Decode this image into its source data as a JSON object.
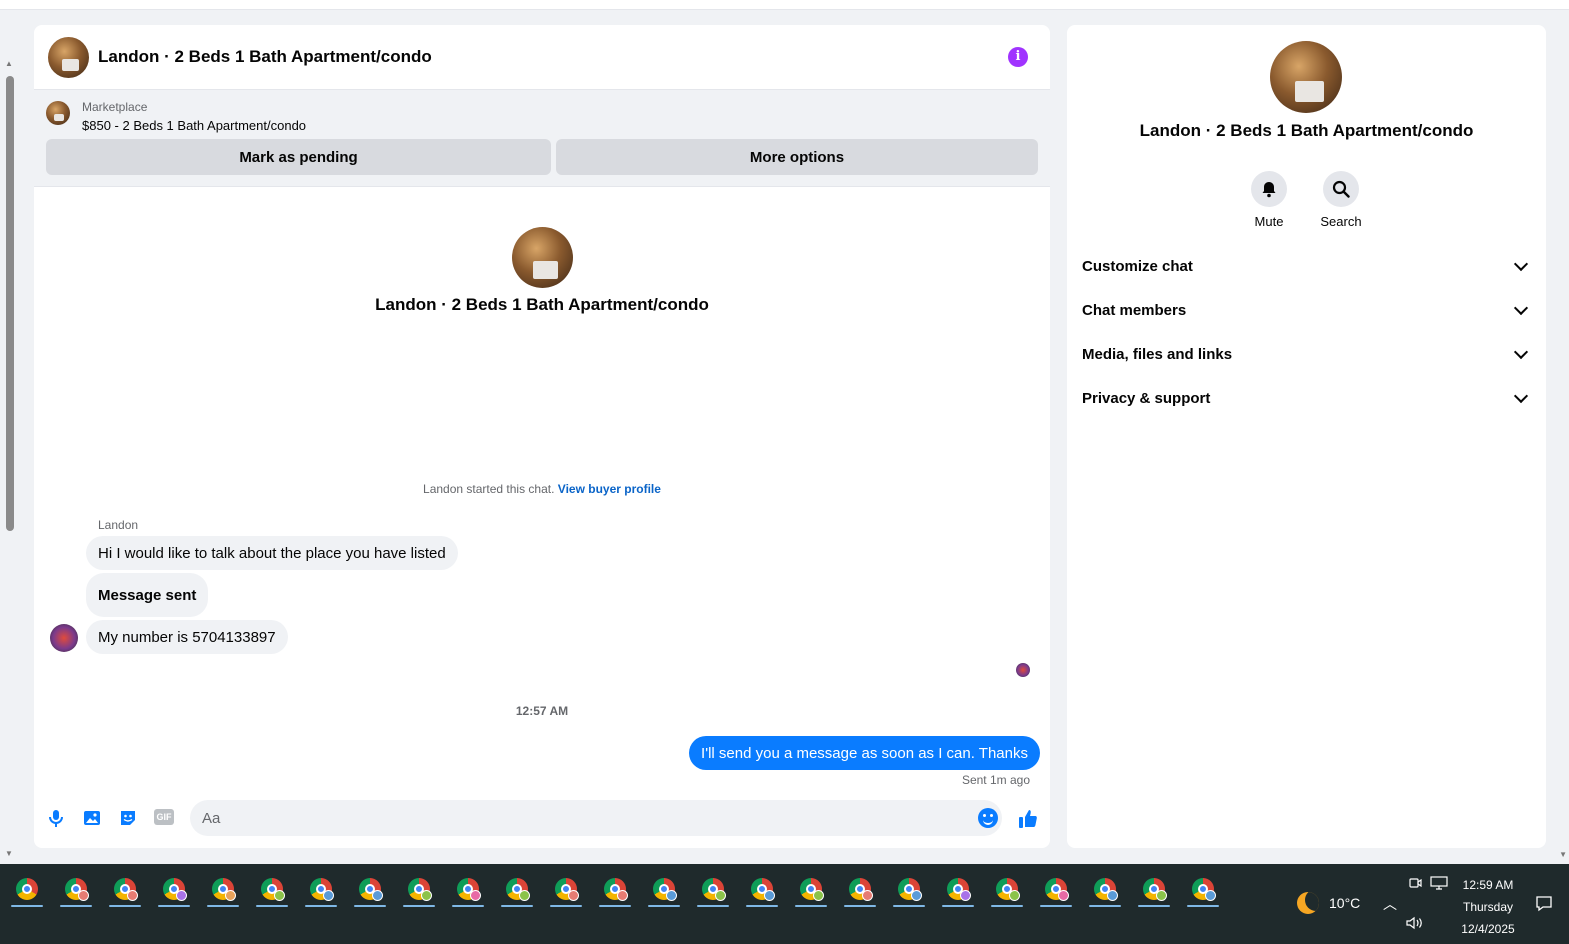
{
  "chat": {
    "title": "Landon · 2 Beds 1 Bath Apartment/condo",
    "marketplace": {
      "label": "Marketplace",
      "listing": "$850 - 2 Beds 1 Bath Apartment/condo",
      "pending_button": "Mark as pending",
      "more_button": "More options"
    },
    "intro_name": "Landon · 2 Beds 1 Bath Apartment/condo",
    "started_text": "Landon started this chat.",
    "buyer_profile_link": "View buyer profile",
    "sender_name": "Landon",
    "messages": [
      "Hi I would like to talk about the place you have listed",
      "Message sent",
      "My number is 5704133897"
    ],
    "timestamp": "12:57 AM",
    "outgoing": "I'll send you a message as soon as I can. Thanks",
    "sent_status": "Sent 1m ago",
    "composer": {
      "placeholder": "Aa",
      "gif_label": "GIF"
    }
  },
  "sidebar": {
    "name": "Landon · 2 Beds 1 Bath Apartment/condo",
    "actions": {
      "mute": "Mute",
      "search": "Search"
    },
    "sections": [
      "Customize chat",
      "Chat members",
      "Media, files and links",
      "Privacy & support"
    ]
  },
  "taskbar": {
    "weather": "10°C",
    "time": "12:59 AM",
    "day": "Thursday",
    "date": "12/4/2025"
  },
  "colors": {
    "accent": "#0a7cff",
    "info": "#a033ff"
  }
}
